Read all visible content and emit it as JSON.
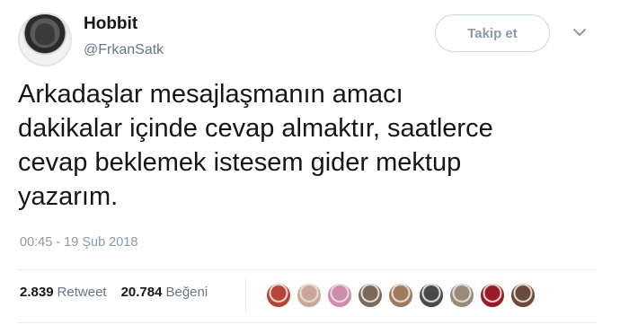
{
  "user": {
    "name": "Hobbit",
    "handle": "@FrkanSatk"
  },
  "follow_button": {
    "label": "Takip et"
  },
  "tweet": {
    "text": "Arkadaşlar mesajlaşmanın amacı\ndakikalar içinde cevap almaktır, saatlerce\ncevap beklemek istesem gider mektup\nyazarım.",
    "timestamp": "00:45 - 19 Şub 2018"
  },
  "stats": {
    "retweets_count": "2.839",
    "retweets_label": "Retweet",
    "likes_count": "20.784",
    "likes_label": "Beğeni"
  },
  "likers": [
    {
      "color": "#b5453a"
    },
    {
      "color": "#c9a89a"
    },
    {
      "color": "#d08ab0"
    },
    {
      "color": "#7a6a5a"
    },
    {
      "color": "#a07a5c"
    },
    {
      "color": "#4a4a4a"
    },
    {
      "color": "#9a8a7a"
    },
    {
      "color": "#9a1a2a"
    },
    {
      "color": "#6a4a3a"
    }
  ],
  "colors": {
    "secondary_text": "#657786",
    "primary_text": "#14171a"
  }
}
